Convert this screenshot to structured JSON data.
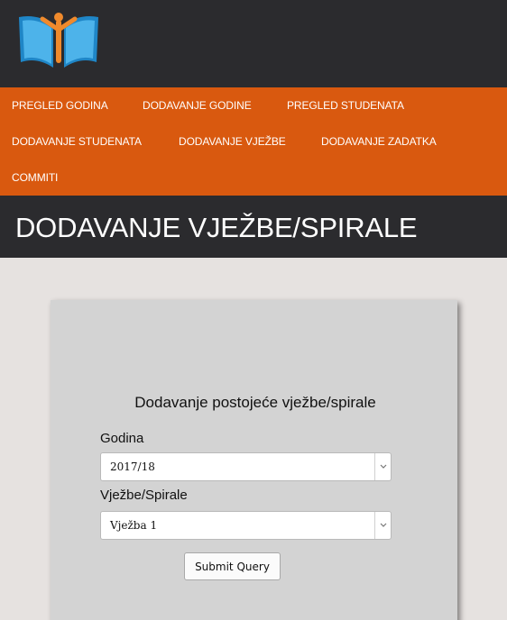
{
  "header": {
    "logo_icon": "book-with-person-logo",
    "background": "#2b2b2e"
  },
  "nav": {
    "background": "#d9590f",
    "items": [
      {
        "label": "PREGLED GODINA"
      },
      {
        "label": "DODAVANJE GODINE"
      },
      {
        "label": "PREGLED STUDENATA"
      },
      {
        "label": "DODAVANJE STUDENATA"
      },
      {
        "label": "DODAVANJE VJEŽBE"
      },
      {
        "label": "DODAVANJE ZADATKA"
      },
      {
        "label": "COMMITI"
      }
    ]
  },
  "page": {
    "title": "DODAVANJE VJEŽBE/SPIRALE"
  },
  "form": {
    "heading": "Dodavanje postojeće vježbe/spirale",
    "godina_label": "Godina",
    "godina_value": "2017/18",
    "vjezbe_label": "Vježbe/Spirale",
    "vjezbe_value": "Vježba 1",
    "submit_label": "Submit Query",
    "dropdown_icon": "chevron-down-icon"
  }
}
